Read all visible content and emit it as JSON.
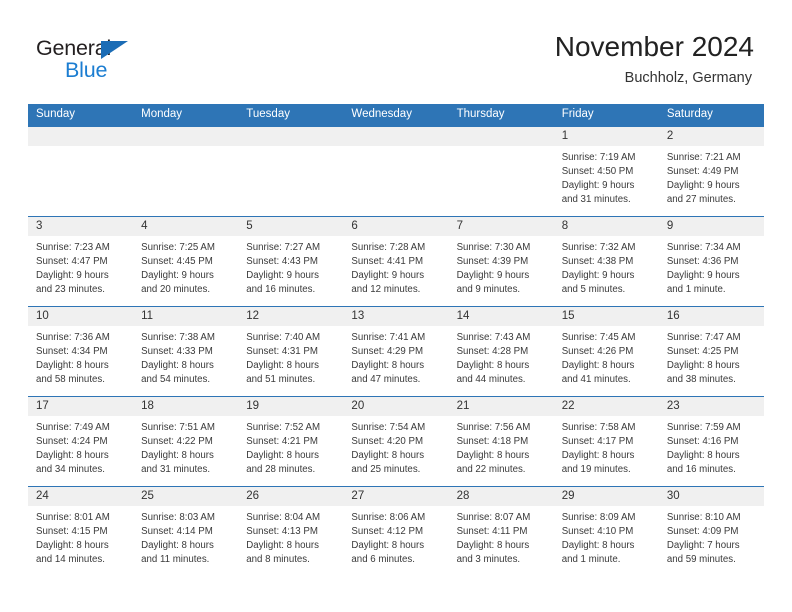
{
  "brand": {
    "name_part1": "General",
    "name_part2": "Blue",
    "triangle_color": "#1b6cb5",
    "blue_color": "#1b7dd1"
  },
  "header": {
    "title": "November 2024",
    "subtitle": "Buchholz, Germany"
  },
  "theme": {
    "header_blue": "#2e75b6",
    "daynum_band": "#f0f0f0",
    "text": "#333333"
  },
  "weekday_headers": [
    "Sunday",
    "Monday",
    "Tuesday",
    "Wednesday",
    "Thursday",
    "Friday",
    "Saturday"
  ],
  "weeks": [
    [
      {
        "day": "",
        "empty": true,
        "l1": "",
        "l2": "",
        "l3": "",
        "l4": ""
      },
      {
        "day": "",
        "empty": true,
        "l1": "",
        "l2": "",
        "l3": "",
        "l4": ""
      },
      {
        "day": "",
        "empty": true,
        "l1": "",
        "l2": "",
        "l3": "",
        "l4": ""
      },
      {
        "day": "",
        "empty": true,
        "l1": "",
        "l2": "",
        "l3": "",
        "l4": ""
      },
      {
        "day": "",
        "empty": true,
        "l1": "",
        "l2": "",
        "l3": "",
        "l4": ""
      },
      {
        "day": "1",
        "l1": "Sunrise: 7:19 AM",
        "l2": "Sunset: 4:50 PM",
        "l3": "Daylight: 9 hours",
        "l4": "and 31 minutes."
      },
      {
        "day": "2",
        "l1": "Sunrise: 7:21 AM",
        "l2": "Sunset: 4:49 PM",
        "l3": "Daylight: 9 hours",
        "l4": "and 27 minutes."
      }
    ],
    [
      {
        "day": "3",
        "l1": "Sunrise: 7:23 AM",
        "l2": "Sunset: 4:47 PM",
        "l3": "Daylight: 9 hours",
        "l4": "and 23 minutes."
      },
      {
        "day": "4",
        "l1": "Sunrise: 7:25 AM",
        "l2": "Sunset: 4:45 PM",
        "l3": "Daylight: 9 hours",
        "l4": "and 20 minutes."
      },
      {
        "day": "5",
        "l1": "Sunrise: 7:27 AM",
        "l2": "Sunset: 4:43 PM",
        "l3": "Daylight: 9 hours",
        "l4": "and 16 minutes."
      },
      {
        "day": "6",
        "l1": "Sunrise: 7:28 AM",
        "l2": "Sunset: 4:41 PM",
        "l3": "Daylight: 9 hours",
        "l4": "and 12 minutes."
      },
      {
        "day": "7",
        "l1": "Sunrise: 7:30 AM",
        "l2": "Sunset: 4:39 PM",
        "l3": "Daylight: 9 hours",
        "l4": "and 9 minutes."
      },
      {
        "day": "8",
        "l1": "Sunrise: 7:32 AM",
        "l2": "Sunset: 4:38 PM",
        "l3": "Daylight: 9 hours",
        "l4": "and 5 minutes."
      },
      {
        "day": "9",
        "l1": "Sunrise: 7:34 AM",
        "l2": "Sunset: 4:36 PM",
        "l3": "Daylight: 9 hours",
        "l4": "and 1 minute."
      }
    ],
    [
      {
        "day": "10",
        "l1": "Sunrise: 7:36 AM",
        "l2": "Sunset: 4:34 PM",
        "l3": "Daylight: 8 hours",
        "l4": "and 58 minutes."
      },
      {
        "day": "11",
        "l1": "Sunrise: 7:38 AM",
        "l2": "Sunset: 4:33 PM",
        "l3": "Daylight: 8 hours",
        "l4": "and 54 minutes."
      },
      {
        "day": "12",
        "l1": "Sunrise: 7:40 AM",
        "l2": "Sunset: 4:31 PM",
        "l3": "Daylight: 8 hours",
        "l4": "and 51 minutes."
      },
      {
        "day": "13",
        "l1": "Sunrise: 7:41 AM",
        "l2": "Sunset: 4:29 PM",
        "l3": "Daylight: 8 hours",
        "l4": "and 47 minutes."
      },
      {
        "day": "14",
        "l1": "Sunrise: 7:43 AM",
        "l2": "Sunset: 4:28 PM",
        "l3": "Daylight: 8 hours",
        "l4": "and 44 minutes."
      },
      {
        "day": "15",
        "l1": "Sunrise: 7:45 AM",
        "l2": "Sunset: 4:26 PM",
        "l3": "Daylight: 8 hours",
        "l4": "and 41 minutes."
      },
      {
        "day": "16",
        "l1": "Sunrise: 7:47 AM",
        "l2": "Sunset: 4:25 PM",
        "l3": "Daylight: 8 hours",
        "l4": "and 38 minutes."
      }
    ],
    [
      {
        "day": "17",
        "l1": "Sunrise: 7:49 AM",
        "l2": "Sunset: 4:24 PM",
        "l3": "Daylight: 8 hours",
        "l4": "and 34 minutes."
      },
      {
        "day": "18",
        "l1": "Sunrise: 7:51 AM",
        "l2": "Sunset: 4:22 PM",
        "l3": "Daylight: 8 hours",
        "l4": "and 31 minutes."
      },
      {
        "day": "19",
        "l1": "Sunrise: 7:52 AM",
        "l2": "Sunset: 4:21 PM",
        "l3": "Daylight: 8 hours",
        "l4": "and 28 minutes."
      },
      {
        "day": "20",
        "l1": "Sunrise: 7:54 AM",
        "l2": "Sunset: 4:20 PM",
        "l3": "Daylight: 8 hours",
        "l4": "and 25 minutes."
      },
      {
        "day": "21",
        "l1": "Sunrise: 7:56 AM",
        "l2": "Sunset: 4:18 PM",
        "l3": "Daylight: 8 hours",
        "l4": "and 22 minutes."
      },
      {
        "day": "22",
        "l1": "Sunrise: 7:58 AM",
        "l2": "Sunset: 4:17 PM",
        "l3": "Daylight: 8 hours",
        "l4": "and 19 minutes."
      },
      {
        "day": "23",
        "l1": "Sunrise: 7:59 AM",
        "l2": "Sunset: 4:16 PM",
        "l3": "Daylight: 8 hours",
        "l4": "and 16 minutes."
      }
    ],
    [
      {
        "day": "24",
        "l1": "Sunrise: 8:01 AM",
        "l2": "Sunset: 4:15 PM",
        "l3": "Daylight: 8 hours",
        "l4": "and 14 minutes."
      },
      {
        "day": "25",
        "l1": "Sunrise: 8:03 AM",
        "l2": "Sunset: 4:14 PM",
        "l3": "Daylight: 8 hours",
        "l4": "and 11 minutes."
      },
      {
        "day": "26",
        "l1": "Sunrise: 8:04 AM",
        "l2": "Sunset: 4:13 PM",
        "l3": "Daylight: 8 hours",
        "l4": "and 8 minutes."
      },
      {
        "day": "27",
        "l1": "Sunrise: 8:06 AM",
        "l2": "Sunset: 4:12 PM",
        "l3": "Daylight: 8 hours",
        "l4": "and 6 minutes."
      },
      {
        "day": "28",
        "l1": "Sunrise: 8:07 AM",
        "l2": "Sunset: 4:11 PM",
        "l3": "Daylight: 8 hours",
        "l4": "and 3 minutes."
      },
      {
        "day": "29",
        "l1": "Sunrise: 8:09 AM",
        "l2": "Sunset: 4:10 PM",
        "l3": "Daylight: 8 hours",
        "l4": "and 1 minute."
      },
      {
        "day": "30",
        "l1": "Sunrise: 8:10 AM",
        "l2": "Sunset: 4:09 PM",
        "l3": "Daylight: 7 hours",
        "l4": "and 59 minutes."
      }
    ]
  ]
}
